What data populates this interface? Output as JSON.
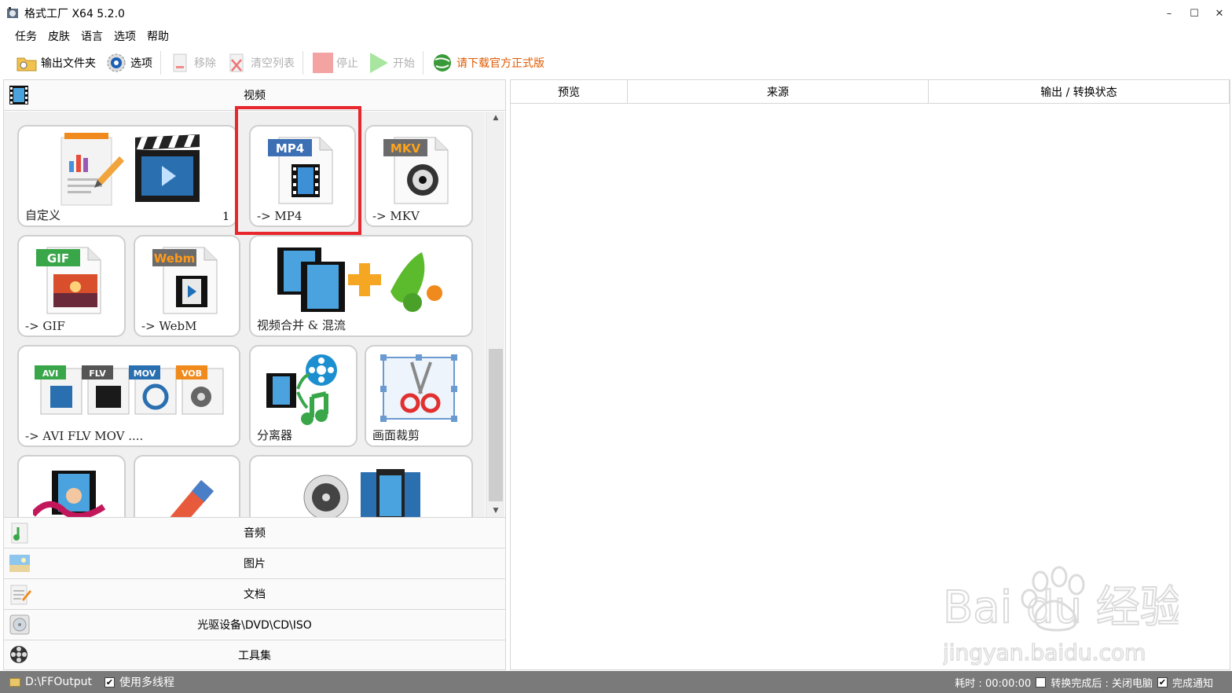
{
  "window": {
    "title": "格式工厂 X64 5.2.0",
    "minimize": "–",
    "maximize": "☐",
    "close": "✕"
  },
  "menu": [
    "任务",
    "皮肤",
    "语言",
    "选项",
    "帮助"
  ],
  "toolbar": {
    "output_folder": "输出文件夹",
    "options": "选项",
    "remove": "移除",
    "clear_list": "清空列表",
    "stop": "停止",
    "start": "开始",
    "download_official": "请下载官方正式版"
  },
  "left": {
    "video_header": "视频",
    "tiles": {
      "custom": {
        "label": "自定义",
        "count": "1"
      },
      "mp4": {
        "label": "-> MP4",
        "badge": "MP4"
      },
      "mkv": {
        "label": "-> MKV",
        "badge": "MKV"
      },
      "gif": {
        "label": "-> GIF",
        "badge": "GIF"
      },
      "webm": {
        "label": "-> WebM",
        "badge": "Webm"
      },
      "merge": {
        "label": "视频合并 & 混流"
      },
      "multi": {
        "label": "-> AVI FLV MOV ....",
        "badges": [
          "AVI",
          "FLV",
          "MOV",
          "VOB"
        ]
      },
      "splitter": {
        "label": "分离器"
      },
      "crop": {
        "label": "画面裁剪"
      }
    },
    "categories": [
      "音频",
      "图片",
      "文档",
      "光驱设备\\DVD\\CD\\ISO",
      "工具集"
    ]
  },
  "right": {
    "columns": [
      "预览",
      "来源",
      "输出 / 转换状态"
    ]
  },
  "watermark": {
    "brand": "Bai du 经验",
    "url": "jingyan.baidu.com"
  },
  "status": {
    "output_path": "D:\\FFOutput",
    "multithread": "使用多线程",
    "elapsed": "耗时 : 00:00:00",
    "after_convert": "转换完成后 : 关闭电脑",
    "notify": "完成通知"
  },
  "colors": {
    "highlight": "#e8262d",
    "promo": "#e05a00",
    "statusbar": "#7a7a7a"
  }
}
